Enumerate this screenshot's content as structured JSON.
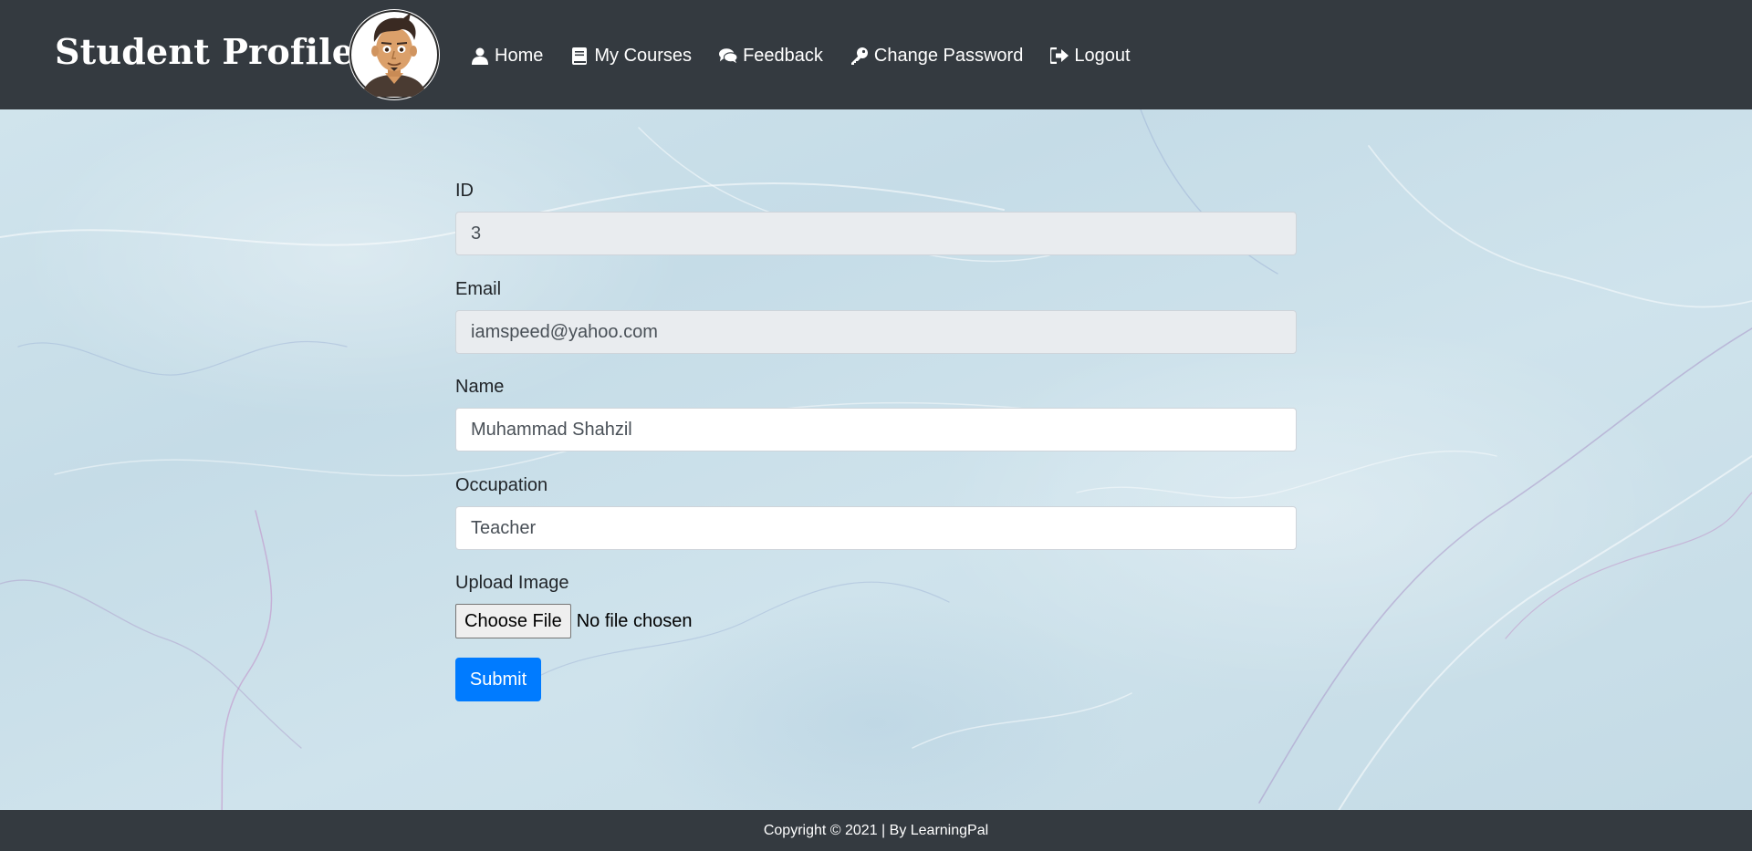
{
  "header": {
    "brand": "Student Profile",
    "nav": [
      {
        "label": "Home",
        "icon": "user-icon"
      },
      {
        "label": "My Courses",
        "icon": "book-icon"
      },
      {
        "label": "Feedback",
        "icon": "comments-icon"
      },
      {
        "label": "Change Password",
        "icon": "key-icon"
      },
      {
        "label": "Logout",
        "icon": "sign-out-icon"
      }
    ]
  },
  "form": {
    "id": {
      "label": "ID",
      "value": "3"
    },
    "email": {
      "label": "Email",
      "value": "iamspeed@yahoo.com"
    },
    "name": {
      "label": "Name",
      "value": "Muhammad Shahzil"
    },
    "occupation": {
      "label": "Occupation",
      "value": "Teacher"
    },
    "upload": {
      "label": "Upload Image",
      "button": "Choose File",
      "status": "No file chosen"
    },
    "submit": "Submit"
  },
  "footer": {
    "text": "Copyright © 2021 | By LearningPal"
  },
  "colors": {
    "navbar": "#343a40",
    "primary": "#007bff",
    "readonly_bg": "#e9ecef"
  }
}
